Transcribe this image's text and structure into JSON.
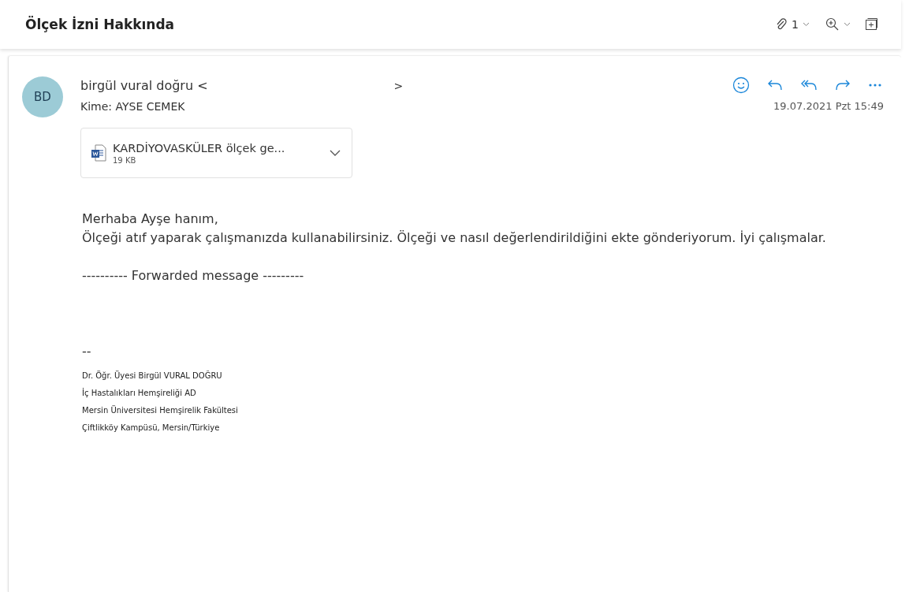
{
  "subject": "Ölçek İzni Hakkında",
  "toolbar": {
    "attachment_count": "1"
  },
  "message": {
    "avatar_initials": "BD",
    "sender": "birgül vural doğru <",
    "sender_end": ">",
    "to_label": "Kime:",
    "to": "AYSE CEMEK",
    "date": "19.07.2021 Pzt 15:49",
    "attachment": {
      "name": "KARDİYOVASKÜLER ölçek ge...",
      "size": "19 KB"
    },
    "body": [
      {
        "kind": "text",
        "text": "Merhaba Ayşe hanım,"
      },
      {
        "kind": "text",
        "text": "Ölçeği atıf yaparak çalışmanızda kullanabilirsiniz. Ölçeği ve nasıl değerlendirildiğini ekte gönderiyorum. İyi çalışmalar."
      },
      {
        "kind": "gap"
      },
      {
        "kind": "text",
        "text": "---------- Forwarded message ---------"
      },
      {
        "kind": "gap"
      },
      {
        "kind": "gap"
      },
      {
        "kind": "gap"
      },
      {
        "kind": "text",
        "text": "--"
      }
    ],
    "signature": [
      "Dr. Öğr. Üyesi Birgül VURAL DOĞRU",
      "İç Hastalıkları Hemşireliği  AD",
      "Mersin Üniversitesi Hemşirelik Fakültesi",
      "Çiftlikköy Kampüsü, Mersin/Türkiye"
    ]
  }
}
